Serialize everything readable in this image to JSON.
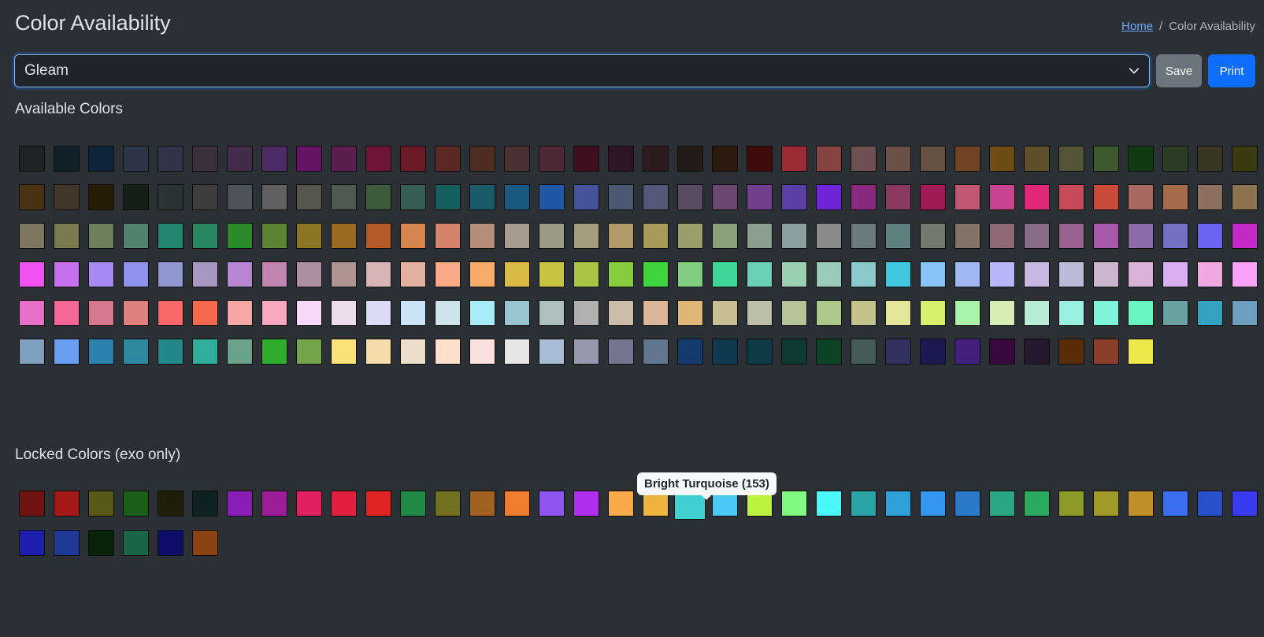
{
  "header": {
    "title": "Color Availability",
    "breadcrumb": {
      "home": "Home",
      "separator": "/",
      "current": "Color Availability"
    }
  },
  "controls": {
    "selected_option": "Gleam",
    "save_label": "Save",
    "print_label": "Print"
  },
  "available": {
    "title": "Available Colors",
    "colors": [
      "#1f2123",
      "#10212a",
      "#0f2438",
      "#2b3545",
      "#313348",
      "#3a2f3c",
      "#432c4a",
      "#4d2a63",
      "#661466",
      "#5c1e4e",
      "#6e1434",
      "#6a1a26",
      "#5c2824",
      "#4f2e22",
      "#4a3232",
      "#4d2834",
      "#3f0f1f",
      "#2e1524",
      "#2c1a1e",
      "#221c18",
      "#2c1a0e",
      "#3f0a0a",
      "#9c2a35",
      "#864543",
      "#6e4f52",
      "#6a5048",
      "#655142",
      "#6f4424",
      "#6e4d15",
      "#5e502a",
      "#545437",
      "#3e5a2c",
      "#123a12",
      "#2b3c24",
      "#363622",
      "#3b3b11",
      "#4a3312",
      "#423628",
      "#271c08",
      "#151e17",
      "#2a3533",
      "#3d3d3d",
      "#4d5458",
      "#606060",
      "#55574a",
      "#4e5a50",
      "#3d5a3d",
      "#365e54",
      "#145e5e",
      "#1a5a6a",
      "#1a5a80",
      "#2058a6",
      "#46529a",
      "#4b5872",
      "#535878",
      "#5b4b62",
      "#6a4870",
      "#733f8c",
      "#5c3fa6",
      "#6f24d8",
      "#8a2a7e",
      "#8a3a60",
      "#a01a56",
      "#c05670",
      "#c84490",
      "#e02878",
      "#c84a5a",
      "#c84a38",
      "#a86a60",
      "#a46a4a",
      "#8c7060",
      "#8c7450",
      "#7d7762",
      "#7a7a50",
      "#6d805c",
      "#538270",
      "#24866e",
      "#2a8660",
      "#2a8a2a",
      "#5a8432",
      "#8a7624",
      "#9a6a22",
      "#b45a28",
      "#d4864e",
      "#d4846a",
      "#b48e78",
      "#a89c90",
      "#9a9c88",
      "#a49c7a",
      "#b09a6a",
      "#a89a58",
      "#9a9e6a",
      "#8aa07a",
      "#8c9e90",
      "#8ca0a0",
      "#8a8a8a",
      "#6c7a80",
      "#5e8080",
      "#747a6e",
      "#847468",
      "#8e6a76",
      "#866e86",
      "#9a6290",
      "#a85aaa",
      "#8c6ca6",
      "#7470c4",
      "#6a64f0",
      "#c42ac8",
      "#f252f2",
      "#c672f0",
      "#a888f2",
      "#8e92ee",
      "#9096d0",
      "#a696c0",
      "#b886d2",
      "#c284b0",
      "#ac90a0",
      "#b09490",
      "#d8b4b4",
      "#e4b0a0",
      "#f8aa88",
      "#f8aa68",
      "#d8ba44",
      "#c8c442",
      "#a8c444",
      "#88cc3e",
      "#3ed43e",
      "#80cc80",
      "#40d698",
      "#6ad0b8",
      "#9ad0b0",
      "#9ccaba",
      "#8acaca",
      "#40c8e0",
      "#88c4f8",
      "#a2b8f4",
      "#b6b6f8",
      "#c6b8e0",
      "#babcd6",
      "#cab6ce",
      "#d8b4d8",
      "#d8b0f0",
      "#f0aae0",
      "#f8a2f8",
      "#e670ca",
      "#f66696",
      "#d4788e",
      "#de8080",
      "#f86868",
      "#f86a50",
      "#f8a6a6",
      "#f8a8c0",
      "#f8d8f8",
      "#ecdcec",
      "#dcdcf8",
      "#cce4f8",
      "#cce4ea",
      "#a8ecf8",
      "#9ac4d0",
      "#aec0be",
      "#b0b0b0",
      "#ccbcaa",
      "#dcb698",
      "#deb678",
      "#c8be96",
      "#bcc0a8",
      "#b4c498",
      "#acc88a",
      "#c2c28a",
      "#e6e69a",
      "#d8f06e",
      "#aaf4aa",
      "#d6eeb6",
      "#b8ecd8",
      "#9af0e0",
      "#80f4da",
      "#6af6c0",
      "#6aa2a2",
      "#34a2c0",
      "#6e9ebe",
      "#80a0c0",
      "#6aa0f4",
      "#2c80ae",
      "#2e88a0",
      "#24888a",
      "#30ae9c",
      "#6aa28c",
      "#2eac2e",
      "#74a44c",
      "#fae278",
      "#f4dcac",
      "#ecdec8",
      "#fce0cc",
      "#fbe0e0",
      "#e6e6e6",
      "#a8bcd4",
      "#9698ae",
      "#757592",
      "#627690",
      "#143a6e",
      "#10384e",
      "#0e3a46",
      "#0e3832",
      "#0e4226",
      "#465a58",
      "#323260",
      "#1a1a50",
      "#42207c",
      "#38083e",
      "#24182c",
      "#5a2c0a",
      "#8c3e2c",
      "#ecea4a"
    ]
  },
  "locked": {
    "title": "Locked Colors (exo only)",
    "tooltip": "Bright Turquoise (153)",
    "active_index": 19,
    "colors": [
      "#6e1212",
      "#a41818",
      "#585818",
      "#1a5e1a",
      "#1e1e0a",
      "#0e2222",
      "#8a1eb6",
      "#9a1e9a",
      "#e02060",
      "#e0203e",
      "#e02424",
      "#1e8a46",
      "#707020",
      "#a06020",
      "#ee7e2e",
      "#8e56f0",
      "#b02ef0",
      "#f8aa48",
      "#eeb43e",
      "#40d0d0",
      "#4ac8f6",
      "#bef240",
      "#80fa80",
      "#4afafa",
      "#2aa4a4",
      "#30a0d8",
      "#3496ee",
      "#2a7ac8",
      "#2aa682",
      "#2aaa60",
      "#8c9a28",
      "#a29a28",
      "#c09028",
      "#3a70f0",
      "#2850c8",
      "#3a3aee",
      "#1e1eae",
      "#1e3896",
      "#0a220a",
      "#1a6448",
      "#0e0e6a",
      "#8a4414"
    ]
  }
}
